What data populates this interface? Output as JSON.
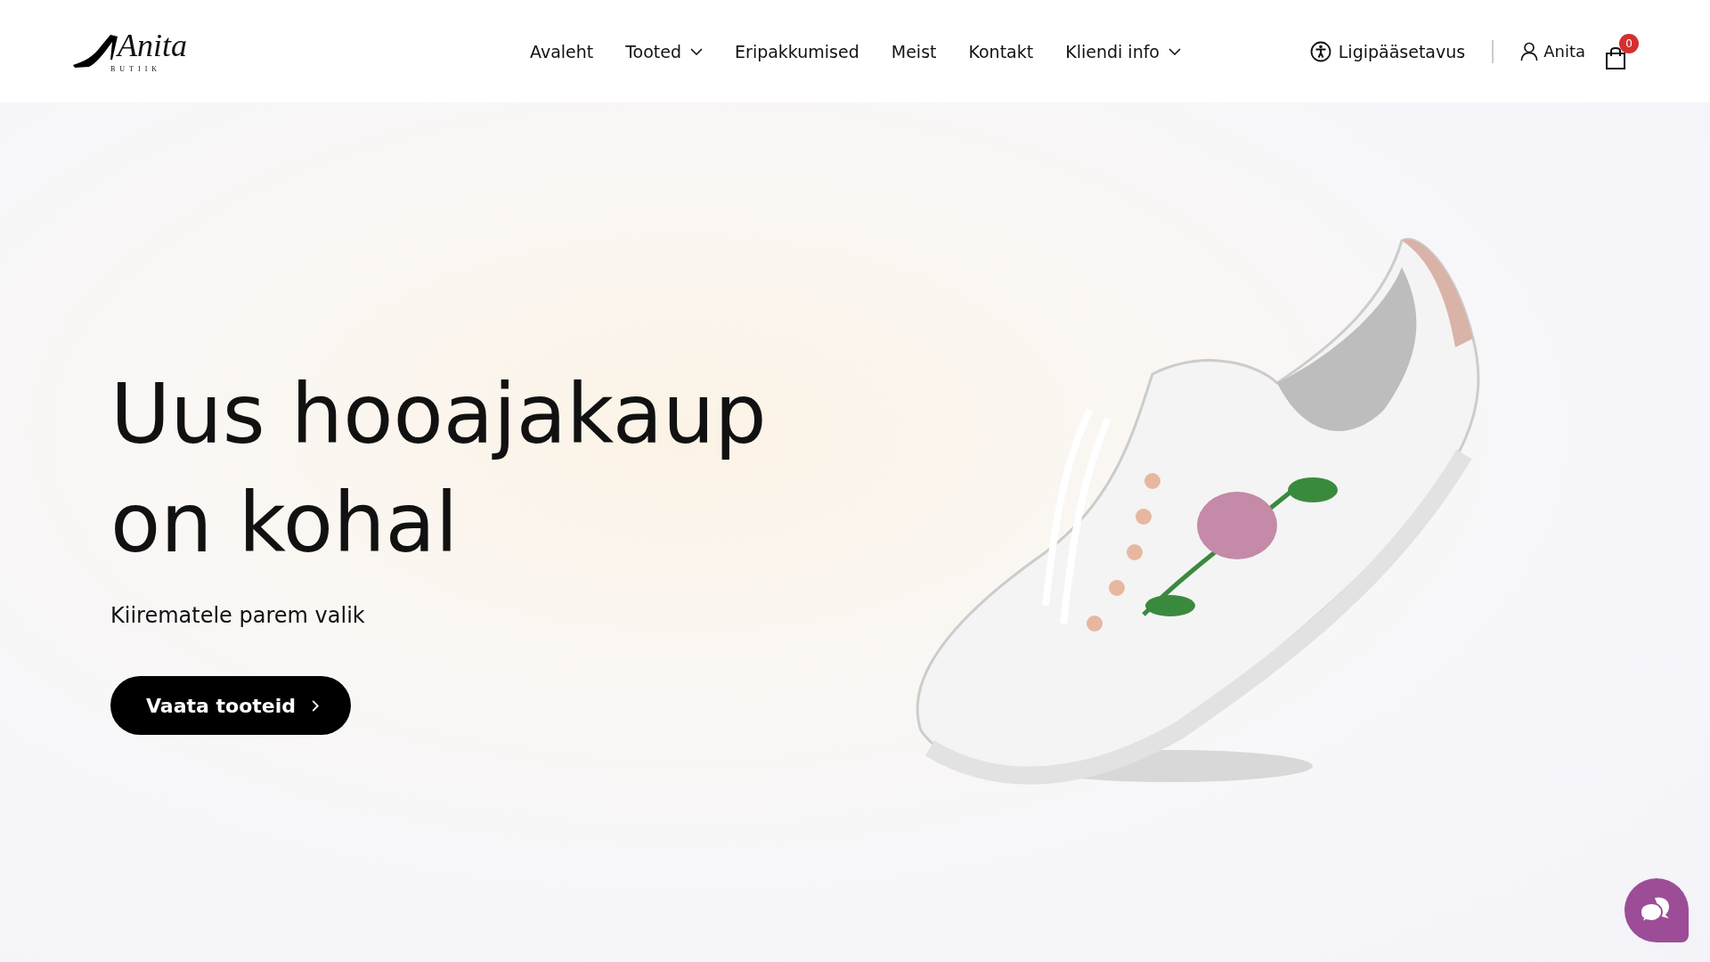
{
  "logo": {
    "name": "Anita",
    "sub": "BUTIIK"
  },
  "nav": [
    {
      "label": "Avaleht",
      "dropdown": false
    },
    {
      "label": "Tooted",
      "dropdown": true
    },
    {
      "label": "Eripakkumised",
      "dropdown": false
    },
    {
      "label": "Meist",
      "dropdown": false
    },
    {
      "label": "Kontakt",
      "dropdown": false
    },
    {
      "label": "Kliendi info",
      "dropdown": true
    }
  ],
  "accessibility": "Ligipääsetavus",
  "account": "Anita",
  "cart_count": "0",
  "hero": {
    "title_lines": [
      "Uus hooajakaup",
      "on kohal"
    ],
    "subtitle": "Kiirematele parem valik",
    "button": "Vaata tooteid"
  }
}
